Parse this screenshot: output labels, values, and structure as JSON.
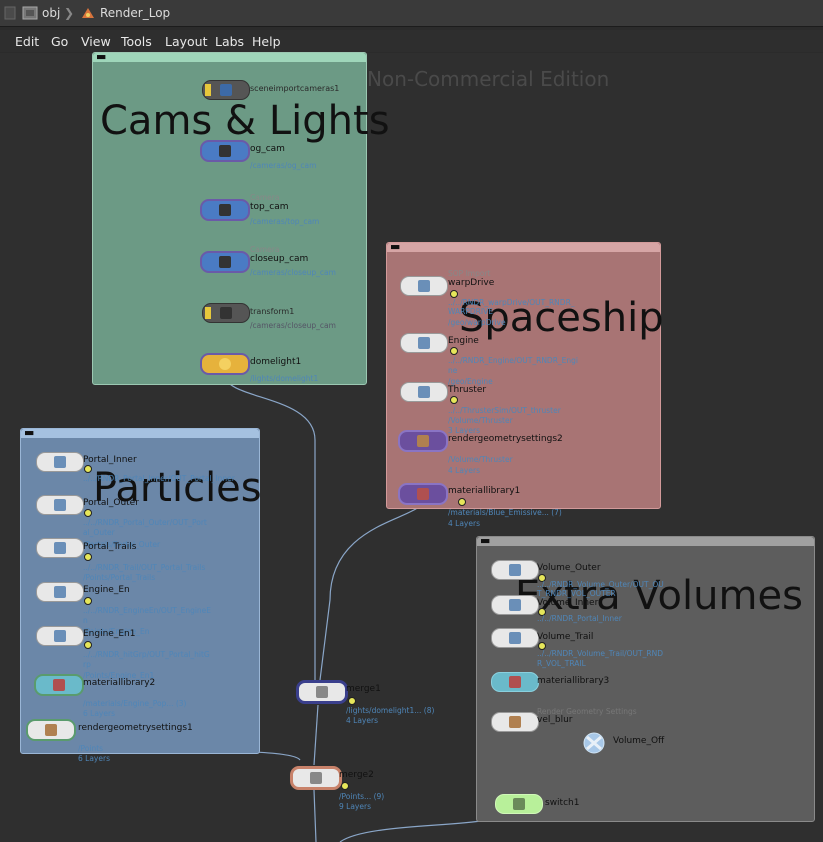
{
  "pathbar": {
    "root": "obj",
    "current": "Render_Lop"
  },
  "menu": {
    "items": [
      "Edit",
      "Go",
      "View",
      "Tools",
      "Layout",
      "Labs",
      "Help"
    ]
  },
  "watermark": "Non-Commercial Edition",
  "colors": {
    "cams_box": "#6c9a85",
    "spaceship_box": "#a87474",
    "particles_box": "#6b87a8",
    "volumes_box": "#5d5d5d",
    "camera_node": "#4a7bc4",
    "light_node": "#e6b23c",
    "purple_node": "#6b4f9e",
    "green_node": "#5a9b6d",
    "teal_node": "#6abaca",
    "switch_node": "#b8f09a",
    "merge_node": "#3a3f8c",
    "merge2_node": "#c8826a"
  },
  "boxes": {
    "cams": {
      "title": "Cams & Lights"
    },
    "spaceship": {
      "title": "Spaceship"
    },
    "particles": {
      "title": "Particles"
    },
    "volumes": {
      "title": "Extra Volumes"
    }
  },
  "nodes": {
    "sceneimportcameras1": {
      "label": "sceneimportcameras1"
    },
    "og_cam": {
      "type": "Camera",
      "label": "og_cam",
      "sub": "/cameras/og_cam"
    },
    "top_cam": {
      "type": "Camera",
      "label": "top_cam",
      "sub": "/cameras/top_cam"
    },
    "closeup_cam": {
      "type": "Camera",
      "label": "closeup_cam",
      "sub": "/cameras/closeup_cam"
    },
    "transform1": {
      "label": "transform1",
      "sub": "/cameras/closeup_cam"
    },
    "domelight1": {
      "label": "domelight1",
      "sub": "/lights/domelight1"
    },
    "warpDrive": {
      "type": "SOP Import",
      "label": "warpDrive",
      "sub1": "../../RNDR_warpDrive/OUT_RNDR_",
      "sub2": "WARPDRIVE",
      "sub3": "/geo/warpDrive"
    },
    "Engine": {
      "label": "Engine",
      "sub1": "../../RNDR_Engine/OUT_RNDR_Engi",
      "sub2": "ne",
      "sub3": "/geo/Engine"
    },
    "Thruster": {
      "label": "Thruster",
      "sub1": "../../ThrusterSim/OUT_thruster",
      "sub2": "/Volume/Thruster",
      "sub3": "3 Layers"
    },
    "rendergeometrysettings2": {
      "label": "rendergeometrysettings2",
      "sub1": "/Volume/Thruster",
      "sub2": "4 Layers"
    },
    "materiallibrary1": {
      "label": "materiallibrary1",
      "sub1": "/materials/Blue_Emissive... (7)",
      "sub2": "4 Layers"
    },
    "Portal_Inner": {
      "label": "Portal_Inner",
      "sub": "../../RNDR_Portal_Inner/OUT_Portal_Inner"
    },
    "Portal_Outer": {
      "label": "Portal_Outer",
      "sub1": "../../RNDR_Portal_Outer/OUT_Port",
      "sub2": "al_Outer",
      "sub3": "/Portals/Portal_Outer"
    },
    "Portal_Trails": {
      "label": "Portal_Trails",
      "sub1": "../../RNDR_Trail/OUT_Portal_Trails",
      "sub2": "/Points/Portal_Trails"
    },
    "Engine_En": {
      "label": "Engine_En",
      "sub1": "../../RNDR_EngineEn/OUT_EngineE",
      "sub2": "n",
      "sub3": "/Points/Engine_En"
    },
    "Engine_En1": {
      "label": "Engine_En1",
      "sub1": "../../RNDR_hitGrp/OUT_Portal_hitG",
      "sub2": "rp",
      "sub3": "/Points/Engine_En1"
    },
    "materiallibrary2": {
      "label": "materiallibrary2",
      "sub1": "/materials/Engine_Pop... (3)",
      "sub2": "6 Layers"
    },
    "rendergeometrysettings1": {
      "label": "rendergeometrysettings1",
      "sub1": "/Points",
      "sub2": "6 Layers"
    },
    "merge1": {
      "label": "merge1",
      "sub1": "/lights/domelight1... (8)",
      "sub2": "4 Layers"
    },
    "merge2": {
      "label": "merge2",
      "sub1": "/Points... (9)",
      "sub2": "9 Layers"
    },
    "Volume_Outer": {
      "label": "Volume_Outer",
      "sub1": "../../RNDR_Volume_Outer/OUT_OU",
      "sub2": "T_RNDR_VOL_OUTER"
    },
    "Volume_Inner": {
      "label": "Volume_Inner",
      "sub": "../../RNDR_Portal_Inner"
    },
    "Volume_Trail": {
      "label": "Volume_Trail",
      "sub1": "../../RNDR_Volume_Trail/OUT_RND",
      "sub2": "R_VOL_TRAIL"
    },
    "materiallibrary3": {
      "label": "materiallibrary3"
    },
    "vel_blur": {
      "type": "Render Geometry Settings",
      "label": "vel_blur"
    },
    "Volume_Off": {
      "label": "Volume_Off"
    },
    "switch1": {
      "label": "switch1"
    }
  }
}
